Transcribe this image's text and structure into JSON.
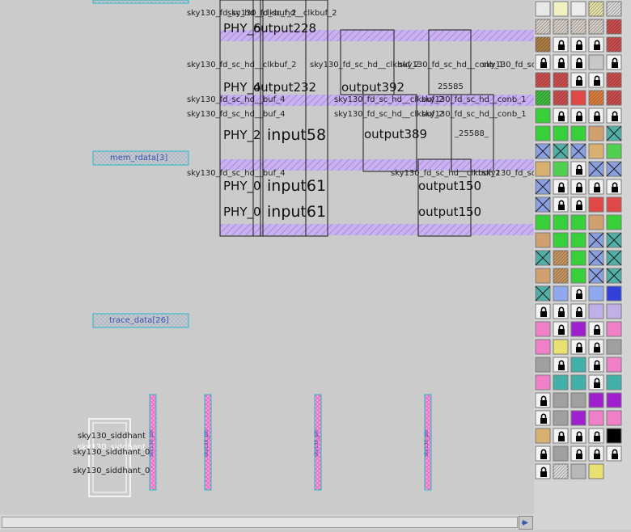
{
  "layout": {
    "cells": [
      "sky130_fd_sc_hd__clkbuf_2",
      "sky130_fd_sc_hd__clkbuf_2",
      "sky130_fd_sc_hd__clkbuf_2",
      "sky130_fd_sc_hd__conb_1",
      "sky130_fd_sc_hd__conb_1",
      "sky130_fd_sc_hd__buf_4",
      "sky130_fd_sc_hd__buf_4",
      "sky130_fd_sc_hd__clkbuf_2",
      "sky130_fd_sc_hd__conb_1",
      "sky130_fd_sc_hd__buf_4",
      "sky130_fd_sc_hd__clkbuf_2",
      "sky130_fd_sc"
    ],
    "instances": [
      "PHY_6",
      "output228",
      "PHY_4",
      "output232",
      "output392",
      "25585",
      "PHY_2",
      "input58",
      "output389",
      "_25588_",
      "PHY_0",
      "input61",
      "output150",
      "PHY_0",
      "input61",
      "output150"
    ],
    "pins": [
      "mem_rdata[3]",
      "trace_data[26]"
    ],
    "siddhant": [
      "sky130_siddhant",
      "sky130_siddhant_0",
      "sky130_siddhant_0",
      "sky130_siddhant"
    ],
    "vertical_labels": [
      "sky130_pin",
      "sky130_pin",
      "sky130_pin",
      "sky130_pin"
    ]
  },
  "palette": {
    "columns": 5,
    "rows": 26,
    "swatches": [
      "grid",
      "yellow-outline",
      "plain-outline",
      "yellow-hatch",
      "hatch",
      "light-hatch",
      "light-hatch",
      "light-hatch",
      "light-hatch",
      "red-hatch",
      "brown-hatch",
      "lock",
      "lock",
      "lock",
      "red-hatch",
      "lock",
      "lock",
      "lock",
      "light",
      "lock",
      "red-hatch",
      "red-hatch",
      "lock",
      "lock",
      "red-hatch",
      "green-hatch",
      "red-hatch",
      "red",
      "orange-hatch",
      "red-hatch",
      "green",
      "lock",
      "lock",
      "lock",
      "lock",
      "green",
      "green",
      "green",
      "tan",
      "teal-x",
      "blue-x",
      "teal-x",
      "blue-x",
      "tan-dot",
      "green-dot",
      "tan-dot",
      "green-dot",
      "lock",
      "blue-x",
      "blue-x",
      "blue-x",
      "lock",
      "lock",
      "lock",
      "lock",
      "blue-x",
      "lock",
      "lock",
      "red",
      "red",
      "green",
      "green",
      "green",
      "tan",
      "green",
      "tan",
      "green",
      "green",
      "blue-x",
      "teal-x",
      "teal-x",
      "tan-hatch",
      "green",
      "blue-x",
      "teal-x",
      "tan",
      "tan-hatch",
      "green",
      "blue-x",
      "teal-x",
      "teal-x",
      "blue-wave",
      "lock",
      "blue-wave",
      "blue-dot",
      "lock",
      "lock",
      "lock",
      "lavender",
      "lavender",
      "pink",
      "lock",
      "purple",
      "lock",
      "pink",
      "pink",
      "yellow",
      "lock",
      "lock",
      "gray",
      "gray",
      "lock",
      "teal",
      "lock",
      "pink",
      "pink",
      "teal",
      "teal",
      "lock",
      "teal",
      "lock",
      "gray",
      "gray",
      "purple",
      "purple",
      "lock",
      "gray",
      "purple",
      "pink",
      "pink",
      "tan-dot",
      "lock",
      "lock",
      "lock",
      "black",
      "lock",
      "gray",
      "lock",
      "lock",
      "lock",
      "lock",
      "hatch",
      "dots",
      "yellow"
    ]
  },
  "colors": {
    "background": "#cbcbcb",
    "met_fill": "#c7aef0",
    "pin_stroke": "#27b8c8",
    "pin_text": "#3a52b0",
    "vpin_fill": "#f29ad0"
  }
}
